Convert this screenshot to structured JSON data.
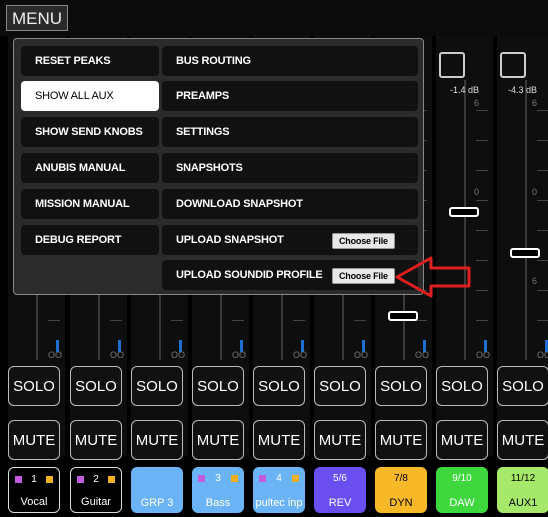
{
  "app": {
    "menu_label": "MENU"
  },
  "menu": {
    "left": [
      "RESET PEAKS",
      "SHOW ALL AUX",
      "SHOW SEND KNOBS",
      "ANUBIS MANUAL",
      "MISSION MANUAL",
      "DEBUG REPORT"
    ],
    "right": [
      "BUS ROUTING",
      "PREAMPS",
      "SETTINGS",
      "SNAPSHOTS",
      "DOWNLOAD SNAPSHOT",
      "UPLOAD SNAPSHOT",
      "UPLOAD SOUNDID PROFILE"
    ],
    "choose_file_label": "Choose File",
    "active_item": "SHOW ALL AUX"
  },
  "meters": {
    "db_daw": "-1.4 dB",
    "db_aux1": "-4.3 dB",
    "scale_6": "6",
    "scale_0": "0",
    "overload": "OO"
  },
  "buttons": {
    "solo": "SOLO",
    "mute": "MUTE"
  },
  "channels": [
    {
      "num": "1",
      "name": "Vocal",
      "color": "#000000",
      "sq_left": "#c45ae0",
      "sq_right": "#f0b020"
    },
    {
      "num": "2",
      "name": "Guitar",
      "color": "#000000",
      "sq_left": "#c45ae0",
      "sq_right": "#f0b020"
    },
    {
      "num": "",
      "name": "GRP 3",
      "color": "#6ab4f5"
    },
    {
      "num": "3",
      "name": "Bass",
      "color": "#6ab4f5",
      "sq_left": "#c45ae0",
      "sq_right": "#f0b020"
    },
    {
      "num": "4",
      "name": "pultec inp",
      "color": "#6ab4f5",
      "sq_left": "#c45ae0",
      "sq_right": "#f0b020"
    },
    {
      "num": "5/6",
      "name": "REV",
      "color": "#6a4ef0"
    },
    {
      "num": "7/8",
      "name": "DYN",
      "color": "#f7b928"
    },
    {
      "num": "9/10",
      "name": "DAW",
      "color": "#3ed83e"
    },
    {
      "num": "11/12",
      "name": "AUX1",
      "color": "#a6e86a"
    }
  ],
  "colors": {
    "accent": "#1e6fd0",
    "arrow": "#e02020"
  }
}
